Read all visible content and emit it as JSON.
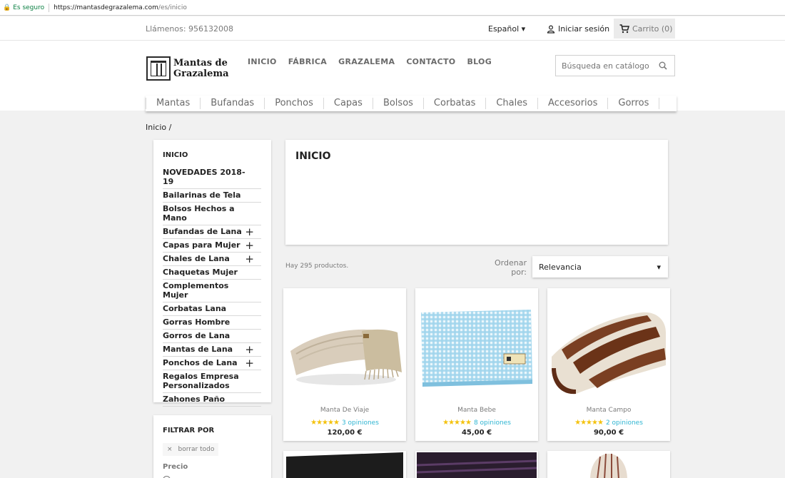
{
  "browser": {
    "secure_label": "Es seguro",
    "url_host": "https://mantasdegrazalema.com",
    "url_path": "/es/inicio"
  },
  "topbar": {
    "phone": "Llámenos: 956132008",
    "language": "Español",
    "signin": "Iniciar sesión",
    "cart": "Carrito (0)"
  },
  "header": {
    "logo_line1": "Mantas de",
    "logo_line2": "Grazalema",
    "nav": [
      "INICIO",
      "FÁBRICA",
      "GRAZALEMA",
      "CONTACTO",
      "BLOG"
    ],
    "search_placeholder": "Búsqueda en catálogo",
    "categories": [
      "Mantas",
      "Bufandas",
      "Ponchos",
      "Capas",
      "Bolsos",
      "Corbatas",
      "Chales",
      "Accesorios",
      "Gorros"
    ]
  },
  "breadcrumb": "Inicio  /",
  "sidebar": {
    "title": "INICIO",
    "items": [
      {
        "label": "NOVEDADES 2018-19",
        "expand": ""
      },
      {
        "label": "Bailarinas de Tela",
        "expand": ""
      },
      {
        "label": "Bolsos Hechos a Mano",
        "expand": ""
      },
      {
        "label": "Bufandas de Lana",
        "expand": "+"
      },
      {
        "label": "Capas para Mujer",
        "expand": "+"
      },
      {
        "label": "Chales de Lana",
        "expand": "+"
      },
      {
        "label": "Chaquetas Mujer",
        "expand": ""
      },
      {
        "label": "Complementos Mujer",
        "expand": ""
      },
      {
        "label": "Corbatas Lana",
        "expand": ""
      },
      {
        "label": "Gorras Hombre",
        "expand": ""
      },
      {
        "label": "Gorros de Lana",
        "expand": ""
      },
      {
        "label": "Mantas de Lana",
        "expand": "+"
      },
      {
        "label": "Ponchos de Lana",
        "expand": "+"
      },
      {
        "label": "Regalos Empresa Personalizados",
        "expand": ""
      },
      {
        "label": "Zahones Paño",
        "expand": ""
      }
    ]
  },
  "filter": {
    "title": "FILTRAR POR",
    "clear_all": "borrar todo",
    "price_label": "Precio"
  },
  "main": {
    "heading": "INICIO",
    "count": "Hay 295 productos.",
    "sort_label": "Ordenar por:",
    "sort_value": "Relevancia"
  },
  "products": [
    {
      "name": "Manta De Viaje",
      "reviews": "3 opiniones",
      "price": "120,00 €",
      "stars": 5
    },
    {
      "name": "Manta Bebe",
      "reviews": "8 opiniones",
      "price": "45,00 €",
      "stars": 5
    },
    {
      "name": "Manta Campo",
      "reviews": "2 opiniones",
      "price": "90,00 €",
      "stars": 5
    }
  ],
  "colors": {
    "link": "#2fb5d2",
    "star": "#f4c20d",
    "secure": "#0b8043"
  }
}
